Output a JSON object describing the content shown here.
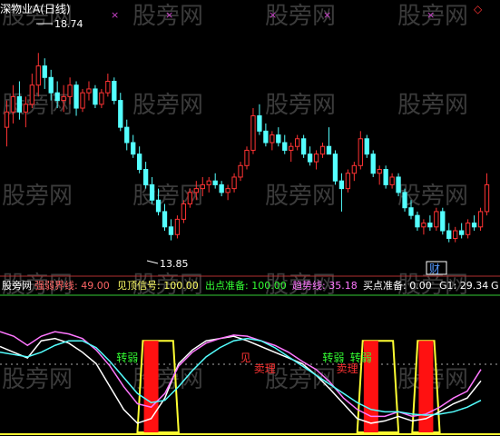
{
  "chart_data": [
    {
      "type": "candlestick",
      "title": "深物业A(日线)",
      "price_range": [
        13.2,
        19.6
      ],
      "annotations": {
        "high_label": "18.74",
        "low_label": "13.85",
        "marker": "财"
      },
      "up_color": "#ff3333",
      "down_color": "#54ffff",
      "candles": [
        [
          16.8,
          17.5,
          16.3,
          17.2
        ],
        [
          17.2,
          17.9,
          16.9,
          17.6
        ],
        [
          17.6,
          18.0,
          17.0,
          17.2
        ],
        [
          17.2,
          17.6,
          16.8,
          17.4
        ],
        [
          17.4,
          18.2,
          17.3,
          17.9
        ],
        [
          17.9,
          18.74,
          17.6,
          18.4
        ],
        [
          18.4,
          18.6,
          17.8,
          18.1
        ],
        [
          18.1,
          18.3,
          17.5,
          17.7
        ],
        [
          17.7,
          18.0,
          17.3,
          17.5
        ],
        [
          17.5,
          17.9,
          17.2,
          17.6
        ],
        [
          17.6,
          18.1,
          17.4,
          17.9
        ],
        [
          17.9,
          18.0,
          17.1,
          17.3
        ],
        [
          17.3,
          17.8,
          17.2,
          17.7
        ],
        [
          17.7,
          18.0,
          17.5,
          17.8
        ],
        [
          17.8,
          17.9,
          17.3,
          17.4
        ],
        [
          17.4,
          17.8,
          17.3,
          17.7
        ],
        [
          17.7,
          18.2,
          17.6,
          18.0
        ],
        [
          18.0,
          18.1,
          17.4,
          17.5
        ],
        [
          17.5,
          17.7,
          16.7,
          16.8
        ],
        [
          16.8,
          17.0,
          16.2,
          16.4
        ],
        [
          16.4,
          16.6,
          16.0,
          16.1
        ],
        [
          16.1,
          16.3,
          15.6,
          15.7
        ],
        [
          15.7,
          15.9,
          15.2,
          15.3
        ],
        [
          15.3,
          15.5,
          14.8,
          14.9
        ],
        [
          14.9,
          15.2,
          14.5,
          14.6
        ],
        [
          14.6,
          14.8,
          14.1,
          14.2
        ],
        [
          14.2,
          14.4,
          13.85,
          14.0
        ],
        [
          14.0,
          14.5,
          13.9,
          14.4
        ],
        [
          14.4,
          14.9,
          14.3,
          14.8
        ],
        [
          14.8,
          15.2,
          14.7,
          15.1
        ],
        [
          15.1,
          15.4,
          14.9,
          15.2
        ],
        [
          15.2,
          15.5,
          15.0,
          15.3
        ],
        [
          15.3,
          15.5,
          15.1,
          15.4
        ],
        [
          15.4,
          15.6,
          15.2,
          15.3
        ],
        [
          15.3,
          15.4,
          15.0,
          15.1
        ],
        [
          15.1,
          15.3,
          14.9,
          15.2
        ],
        [
          15.2,
          15.6,
          15.1,
          15.5
        ],
        [
          15.5,
          15.9,
          15.4,
          15.8
        ],
        [
          15.8,
          16.3,
          15.7,
          16.2
        ],
        [
          16.2,
          17.3,
          16.1,
          17.1
        ],
        [
          17.1,
          17.4,
          16.6,
          16.7
        ],
        [
          16.7,
          16.9,
          16.3,
          16.4
        ],
        [
          16.4,
          16.7,
          16.2,
          16.6
        ],
        [
          16.6,
          16.8,
          16.3,
          16.4
        ],
        [
          16.4,
          16.6,
          16.1,
          16.2
        ],
        [
          16.2,
          16.4,
          15.9,
          16.3
        ],
        [
          16.3,
          16.6,
          16.2,
          16.5
        ],
        [
          16.5,
          16.6,
          16.0,
          16.1
        ],
        [
          16.1,
          16.3,
          15.8,
          15.9
        ],
        [
          15.9,
          16.2,
          15.7,
          16.1
        ],
        [
          16.1,
          16.4,
          16.0,
          16.3
        ],
        [
          16.3,
          16.8,
          16.2,
          16.1
        ],
        [
          16.1,
          16.2,
          15.3,
          15.4
        ],
        [
          15.4,
          15.6,
          14.6,
          15.2
        ],
        [
          15.2,
          15.7,
          15.1,
          15.6
        ],
        [
          15.6,
          15.9,
          15.4,
          15.8
        ],
        [
          15.8,
          16.7,
          15.7,
          16.5
        ],
        [
          16.5,
          16.6,
          16.0,
          16.1
        ],
        [
          16.1,
          16.2,
          15.5,
          15.6
        ],
        [
          15.6,
          15.8,
          15.3,
          15.7
        ],
        [
          15.7,
          15.8,
          15.2,
          15.3
        ],
        [
          15.3,
          15.6,
          15.2,
          15.5
        ],
        [
          15.5,
          15.6,
          15.0,
          15.1
        ],
        [
          15.1,
          15.2,
          14.6,
          14.7
        ],
        [
          14.7,
          14.9,
          14.4,
          14.5
        ],
        [
          14.5,
          14.6,
          14.1,
          14.2
        ],
        [
          14.2,
          14.4,
          14.0,
          14.3
        ],
        [
          14.3,
          14.5,
          14.1,
          14.2
        ],
        [
          14.2,
          14.7,
          14.1,
          14.6
        ],
        [
          14.6,
          14.7,
          14.0,
          14.1
        ],
        [
          14.1,
          14.3,
          13.8,
          13.9
        ],
        [
          13.9,
          14.2,
          13.8,
          14.1
        ],
        [
          14.1,
          14.3,
          13.9,
          14.0
        ],
        [
          14.0,
          14.4,
          13.9,
          14.3
        ],
        [
          14.3,
          14.5,
          14.1,
          14.2
        ],
        [
          14.2,
          14.7,
          14.1,
          14.6
        ],
        [
          14.6,
          15.6,
          14.5,
          15.3
        ]
      ]
    },
    {
      "type": "line",
      "title": "强弱界线: 49.00",
      "title_color": "#ff6666",
      "readouts": [
        {
          "label": "见顶信号: 100.00",
          "color": "#ffff66"
        },
        {
          "label": "出点准备: 100.00",
          "color": "#33ff33"
        },
        {
          "label": "趋势线: 35.18",
          "color": "#ff77ff"
        },
        {
          "label": "买点准备: 0.00",
          "color": "#ffffff"
        },
        {
          "label": "G1: 29.34",
          "color": "#ffffff"
        },
        {
          "label": "G",
          "color": "#ffffff"
        }
      ],
      "ylim": [
        0,
        100
      ],
      "reference_level": 49,
      "series": [
        {
          "color": "#ffffff",
          "values": [
            75,
            70,
            65,
            80,
            82,
            78,
            70,
            60,
            40,
            20,
            8,
            12,
            30,
            60,
            72,
            80,
            82,
            84,
            80,
            75,
            70,
            65,
            60,
            50,
            38,
            25,
            12,
            8,
            10,
            14,
            10,
            12,
            18,
            25,
            30,
            45
          ]
        },
        {
          "color": "#ff77ff",
          "values": [
            88,
            84,
            76,
            84,
            88,
            86,
            82,
            72,
            58,
            40,
            25,
            22,
            34,
            58,
            70,
            78,
            82,
            85,
            84,
            80,
            76,
            70,
            62,
            55,
            44,
            30,
            20,
            14,
            14,
            18,
            14,
            16,
            22,
            30,
            36,
            55
          ]
        },
        {
          "color": "#54ffff",
          "values": [
            70,
            68,
            66,
            70,
            76,
            80,
            80,
            74,
            62,
            48,
            34,
            26,
            28,
            40,
            54,
            66,
            74,
            80,
            82,
            80,
            74,
            66,
            58,
            50,
            42,
            34,
            26,
            20,
            18,
            18,
            16,
            15,
            16,
            18,
            22,
            28
          ]
        }
      ],
      "trend_shading": [
        {
          "from": 10,
          "to": 13,
          "height": 80
        },
        {
          "from": 26,
          "to": 29,
          "height": 80
        },
        {
          "from": 30,
          "to": 32,
          "height": 80
        }
      ],
      "bars": [
        {
          "at": 11,
          "value": 80
        },
        {
          "at": 27,
          "value": 80
        },
        {
          "at": 31,
          "value": 80
        }
      ],
      "labels": [
        {
          "text": "转弱",
          "at": 9,
          "color": "#33ff33"
        },
        {
          "text": "见",
          "at": 18,
          "color": "#ff3333"
        },
        {
          "text": "卖理",
          "at": 19,
          "color": "#ff3333"
        },
        {
          "text": "转弱",
          "at": 24,
          "color": "#33ff33"
        },
        {
          "text": "卖理",
          "at": 25,
          "color": "#ff3333"
        },
        {
          "text": "转弱",
          "at": 26,
          "color": "#33ff33"
        }
      ]
    }
  ],
  "watermark": {
    "text": "股旁网"
  },
  "markers": {
    "symbol": "×"
  }
}
